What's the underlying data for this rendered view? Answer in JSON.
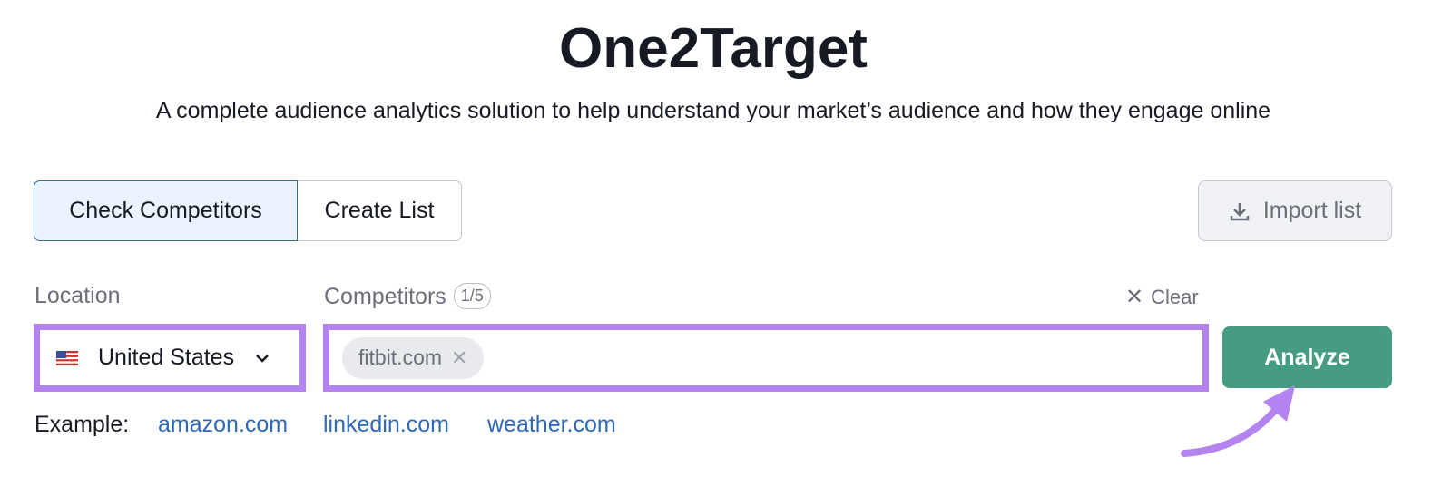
{
  "header": {
    "title": "One2Target",
    "subtitle": "A complete audience analytics solution to help understand your market’s audience and how they engage online"
  },
  "tabs": [
    {
      "label": "Check Competitors",
      "active": true
    },
    {
      "label": "Create List",
      "active": false
    }
  ],
  "import_button": {
    "label": "Import list",
    "icon": "download-icon"
  },
  "location": {
    "label": "Location",
    "value": "United States",
    "flag": "us-flag-icon"
  },
  "competitors": {
    "label": "Competitors",
    "count": "1/5",
    "chips": [
      "fitbit.com"
    ],
    "clear_label": "Clear"
  },
  "analyze_button": {
    "label": "Analyze",
    "color": "#469c82"
  },
  "examples": {
    "label": "Example:",
    "links": [
      "amazon.com",
      "linkedin.com",
      "weather.com"
    ]
  },
  "highlight_color": "#b383f0"
}
